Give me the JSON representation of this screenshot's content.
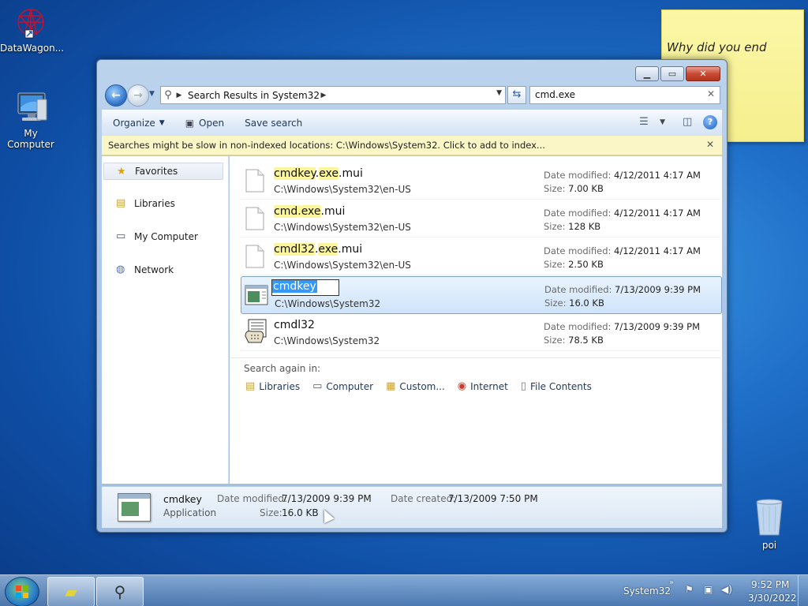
{
  "desktop": {
    "icons": [
      {
        "label": "DataWagon...",
        "icon": "datawagon-icon"
      },
      {
        "label": "My Computer",
        "icon": "computer-icon"
      },
      {
        "label": "poi",
        "icon": "recycle-bin-icon"
      }
    ],
    "sticky_note": {
      "text": "Why did you end"
    }
  },
  "window": {
    "address": {
      "breadcrumb": "Search Results in System32"
    },
    "search": {
      "value": "cmd.exe"
    },
    "toolbar": {
      "organize": "Organize",
      "open": "Open",
      "save_search": "Save search"
    },
    "infobar": {
      "text": "Searches might be slow in non-indexed locations: C:\\Windows\\System32. Click to add to index..."
    },
    "nav": {
      "favorites": "Favorites",
      "libraries": "Libraries",
      "my_computer": "My Computer",
      "network": "Network"
    },
    "labels": {
      "date_modified": "Date modified:",
      "size": "Size:"
    },
    "results": [
      {
        "name_parts": [
          "cmdkey",
          ".",
          "exe",
          ".",
          "mui"
        ],
        "path": "C:\\Windows\\System32\\en-US",
        "date_modified": "4/12/2011 4:17 AM",
        "size": "7.00 KB"
      },
      {
        "name_parts": [
          "cmd",
          ".",
          "exe",
          ".",
          "mui"
        ],
        "path": "C:\\Windows\\System32\\en-US",
        "date_modified": "4/12/2011 4:17 AM",
        "size": "128 KB"
      },
      {
        "name_parts": [
          "cmdl32",
          ".",
          "exe",
          ".",
          "mui"
        ],
        "path": "C:\\Windows\\System32\\en-US",
        "date_modified": "4/12/2011 4:17 AM",
        "size": "2.50 KB"
      },
      {
        "name": "cmdkey",
        "path": "C:\\Windows\\System32",
        "date_modified": "7/13/2009 9:39 PM",
        "size": "16.0 KB",
        "selected": true,
        "renaming": true
      },
      {
        "name": "cmdl32",
        "path": "C:\\Windows\\System32",
        "date_modified": "7/13/2009 9:39 PM",
        "size": "78.5 KB"
      }
    ],
    "search_again": {
      "label": "Search again in:",
      "items": [
        "Libraries",
        "Computer",
        "Custom...",
        "Internet",
        "File Contents"
      ]
    },
    "details": {
      "name": "cmdkey",
      "type": "Application",
      "date_modified_label": "Date modified:",
      "date_modified": "7/13/2009 9:39 PM",
      "size_label": "Size:",
      "size": "16.0 KB",
      "date_created_label": "Date created:",
      "date_created": "7/13/2009 7:50 PM"
    }
  },
  "taskbar": {
    "tray_label": "System32",
    "time": "9:52 PM",
    "date": "3/30/2022"
  }
}
